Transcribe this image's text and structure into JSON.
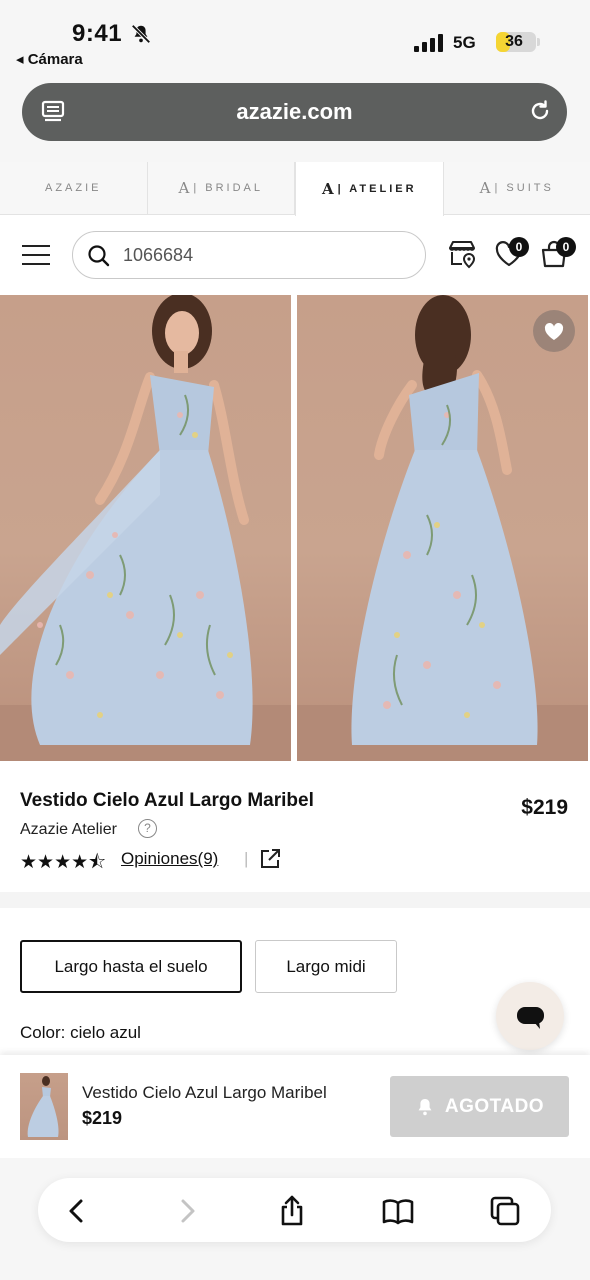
{
  "status": {
    "time": "9:41",
    "back_app": "◂ Cámara",
    "network": "5G",
    "battery_level": 36,
    "battery_text": "36"
  },
  "browser": {
    "url": "azazie.com"
  },
  "brand_tabs": [
    {
      "label": "AZAZIE",
      "mark": ""
    },
    {
      "label": "| BRIDAL",
      "mark": "A"
    },
    {
      "label": "| ATELIER",
      "mark": "A"
    },
    {
      "label": "| SUITS",
      "mark": "A"
    }
  ],
  "header": {
    "search_value": "1066684",
    "wishlist_count": "0",
    "cart_count": "0"
  },
  "product": {
    "name": "Vestido Cielo Azul Largo Maribel",
    "price": "$219",
    "brand": "Azazie Atelier",
    "help": "?",
    "rating": 4.5,
    "stars": "★★★★⯪",
    "reviews_label": "Opiniones(9)",
    "separator": "|"
  },
  "options": {
    "length": [
      "Largo hasta el suelo",
      "Largo midi"
    ],
    "selected_length": "Largo hasta el suelo",
    "color_label": "Color: cielo azul"
  },
  "sticky": {
    "name": "Vestido Cielo Azul Largo Maribel",
    "price": "$219",
    "button": "AGOTADO"
  },
  "colors": {
    "dress": "#b9cbe0",
    "backdrop": "#c69f8a",
    "urlbar": "#5d5f5e",
    "soldout": "#cfcfcf"
  }
}
